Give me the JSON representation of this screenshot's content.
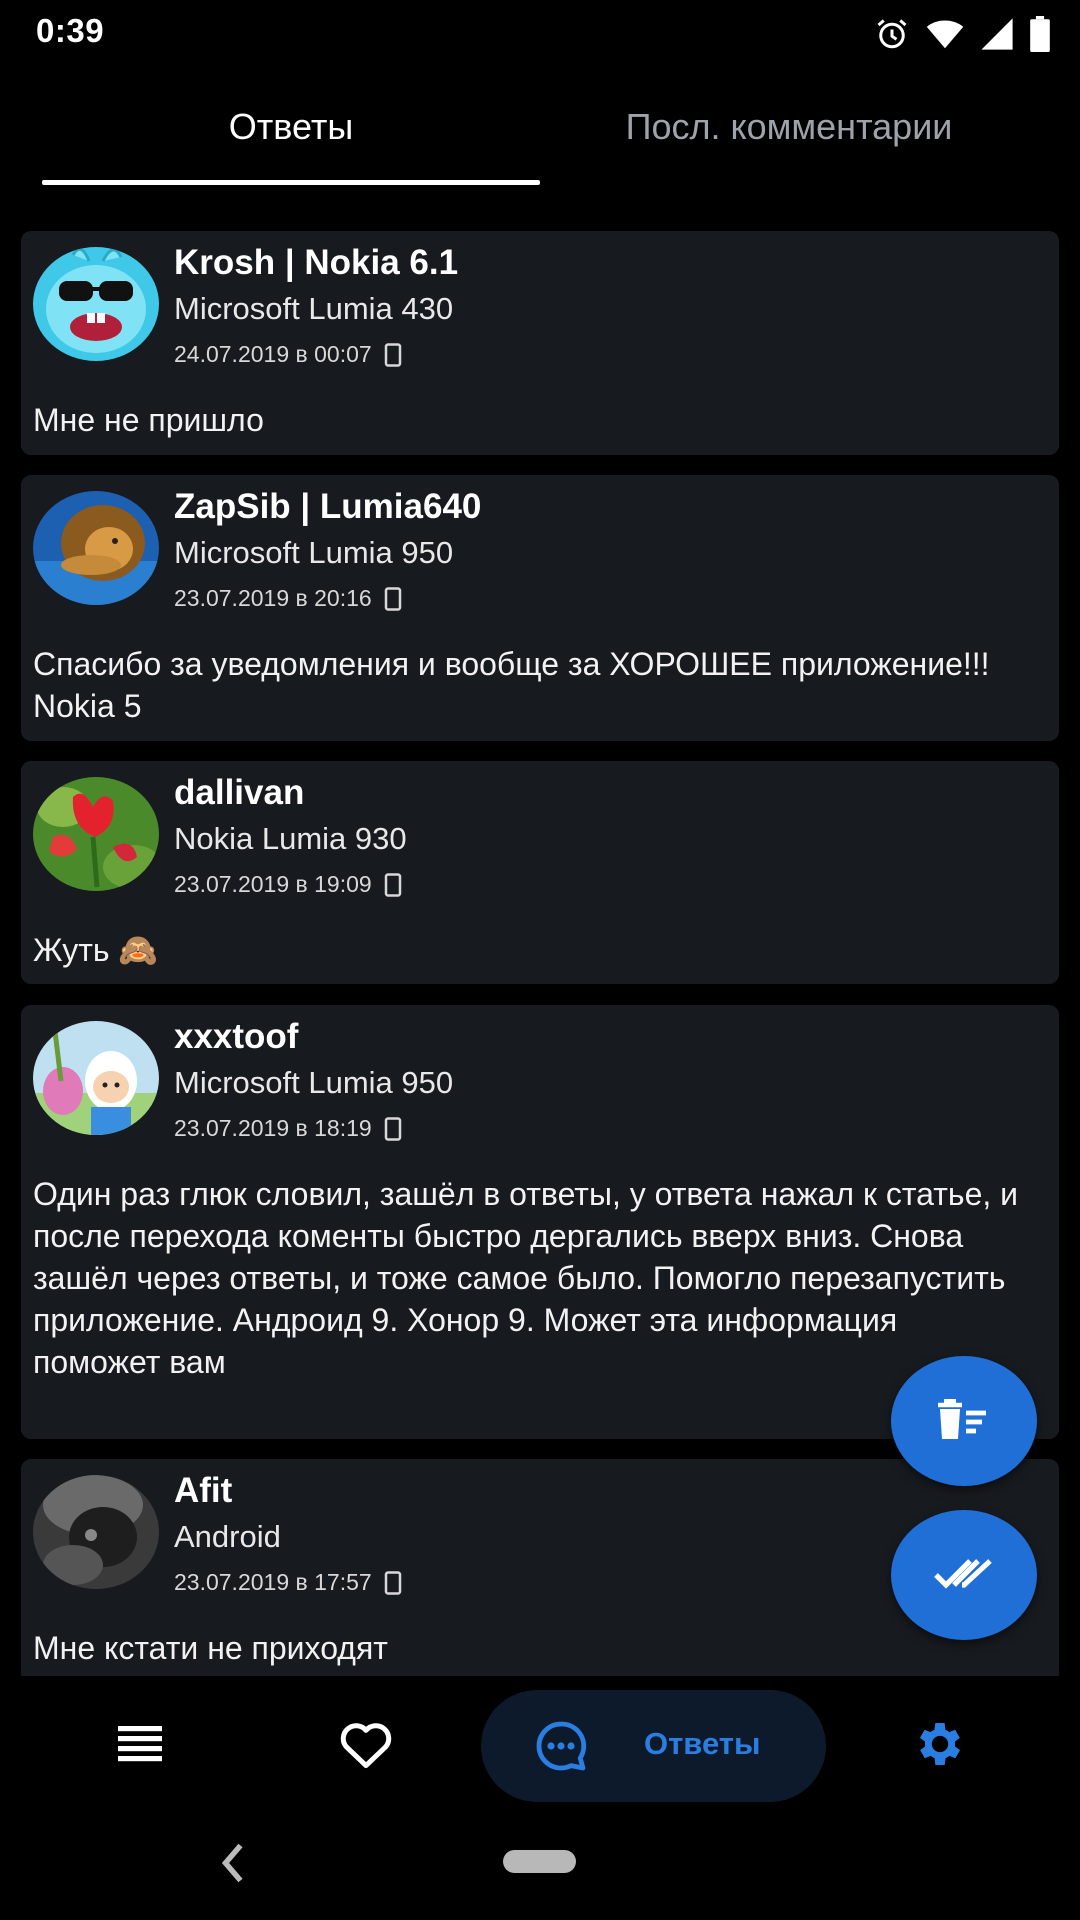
{
  "status_bar": {
    "time": "0:39",
    "icons": [
      "alarm-icon",
      "wifi-icon",
      "signal-icon",
      "battery-icon"
    ]
  },
  "tabs": [
    {
      "label": "Ответы",
      "active": true
    },
    {
      "label": "Посл. комментарии",
      "active": false
    }
  ],
  "comments": [
    {
      "author": "Krosh | Nokia 6.1",
      "device": "Microsoft Lumia 430",
      "datetime": "24.07.2019 в 00:07",
      "text": "Мне не пришло",
      "avatar": "krosh-avatar"
    },
    {
      "author": "ZapSib | Lumia640",
      "device": "Microsoft Lumia 950",
      "datetime": "23.07.2019 в 20:16",
      "text": "Спасибо за уведомления и вообще за ХОРОШЕЕ приложение!!! Nokia 5",
      "avatar": "lion-avatar"
    },
    {
      "author": "dallivan",
      "device": "Nokia Lumia 930",
      "datetime": "23.07.2019 в 19:09",
      "text": "Жуть 🙈",
      "avatar": "tulip-avatar"
    },
    {
      "author": "xxxtoof",
      "device": "Microsoft Lumia 950",
      "datetime": "23.07.2019 в 18:19",
      "text": "Один раз глюк словил, зашёл в ответы, у ответа нажал к статье, и после перехода коменты быстро дергались вверх вниз. Снова зашёл через ответы, и тоже самое было. Помогло перезапустить приложение. Андроид 9. Хонор 9. Может эта информация поможет вам",
      "avatar": "cartoon-avatar"
    },
    {
      "author": "Afit",
      "device": "Android",
      "datetime": "23.07.2019 в 17:57",
      "text": "Мне кстати не приходят",
      "avatar": "dark-photo-avatar"
    }
  ],
  "fabs": {
    "clear": "delete-sweep-icon",
    "mark_read": "done-all-icon"
  },
  "bottom_nav": {
    "items": [
      {
        "icon": "feed-list-icon"
      },
      {
        "icon": "heart-icon"
      },
      {
        "icon": "chat-bubble-icon",
        "label": "Ответы",
        "active": true
      },
      {
        "icon": "gear-icon"
      }
    ]
  },
  "colors": {
    "background": "#000000",
    "card": "#171a1f",
    "accent": "#2a7de1",
    "fab": "#1f6fd6",
    "active_pill": "#0c1a2c"
  }
}
